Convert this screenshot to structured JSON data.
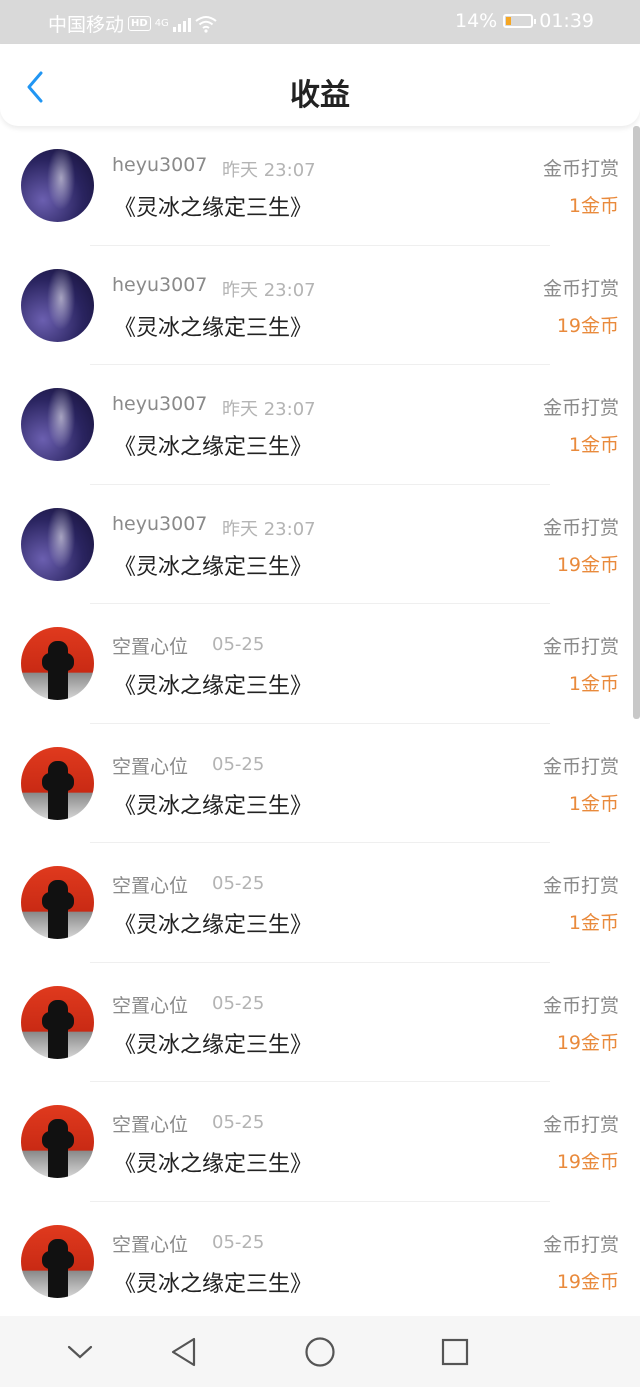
{
  "status_bar": {
    "carrier": "中国移动",
    "hd": "HD",
    "network": "4G",
    "battery": "14%",
    "time": "01:39"
  },
  "header": {
    "title": "收益"
  },
  "entries": [
    {
      "avatar": "galaxy",
      "user": "heyu3007",
      "time": "昨天 23:07",
      "book": "《灵冰之缘定三生》",
      "type": "金币打赏",
      "amount": "1金币"
    },
    {
      "avatar": "galaxy",
      "user": "heyu3007",
      "time": "昨天 23:07",
      "book": "《灵冰之缘定三生》",
      "type": "金币打赏",
      "amount": "19金币"
    },
    {
      "avatar": "galaxy",
      "user": "heyu3007",
      "time": "昨天 23:07",
      "book": "《灵冰之缘定三生》",
      "type": "金币打赏",
      "amount": "1金币"
    },
    {
      "avatar": "galaxy",
      "user": "heyu3007",
      "time": "昨天 23:07",
      "book": "《灵冰之缘定三生》",
      "type": "金币打赏",
      "amount": "19金币"
    },
    {
      "avatar": "red",
      "user": "空置心位",
      "time": "05-25",
      "book": "《灵冰之缘定三生》",
      "type": "金币打赏",
      "amount": "1金币"
    },
    {
      "avatar": "red",
      "user": "空置心位",
      "time": "05-25",
      "book": "《灵冰之缘定三生》",
      "type": "金币打赏",
      "amount": "1金币"
    },
    {
      "avatar": "red",
      "user": "空置心位",
      "time": "05-25",
      "book": "《灵冰之缘定三生》",
      "type": "金币打赏",
      "amount": "1金币"
    },
    {
      "avatar": "red",
      "user": "空置心位",
      "time": "05-25",
      "book": "《灵冰之缘定三生》",
      "type": "金币打赏",
      "amount": "19金币"
    },
    {
      "avatar": "red",
      "user": "空置心位",
      "time": "05-25",
      "book": "《灵冰之缘定三生》",
      "type": "金币打赏",
      "amount": "19金币"
    },
    {
      "avatar": "red",
      "user": "空置心位",
      "time": "05-25",
      "book": "《灵冰之缘定三生》",
      "type": "金币打赏",
      "amount": "19金币"
    }
  ],
  "colors": {
    "accent": "#2196f3",
    "amount": "#e98a3c",
    "status_bar": "#d9d9d9"
  },
  "nav": [
    "chevron-down-icon",
    "back-triangle-icon",
    "home-circle-icon",
    "recents-square-icon"
  ]
}
